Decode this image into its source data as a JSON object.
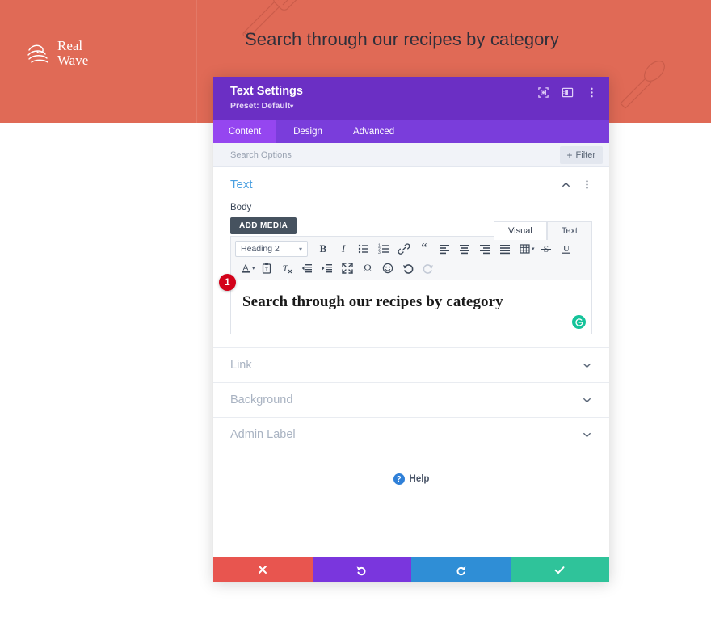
{
  "site": {
    "logo_line1": "Real",
    "logo_line2": "Wave",
    "logo_icon": "wave-lines-icon",
    "hero_heading": "Search through our recipes by category",
    "background_color": "#e06a56",
    "decorations": [
      "rolling-pin-icon",
      "spoon-icon"
    ]
  },
  "modal": {
    "title": "Text Settings",
    "preset_label": "Preset: Default",
    "preset_caret": "▾",
    "header_color": "#6b2fc4",
    "header_icons": [
      {
        "name": "focus-target-icon"
      },
      {
        "name": "panel-layout-icon"
      },
      {
        "name": "vertical-dots-icon"
      }
    ],
    "tabs": [
      {
        "label": "Content",
        "active": true
      },
      {
        "label": "Design",
        "active": false
      },
      {
        "label": "Advanced",
        "active": false
      }
    ],
    "search": {
      "placeholder": "Search Options",
      "filter_label": "Filter",
      "filter_plus": "+"
    },
    "section": {
      "title": "Text",
      "title_color": "#4a9fe0",
      "collapse_icon": "chevron-up-icon",
      "more_icon": "vertical-dots-icon",
      "field_label": "Body",
      "add_media_label": "ADD MEDIA",
      "editor_tabs": [
        {
          "label": "Visual",
          "active": true
        },
        {
          "label": "Text",
          "active": false
        }
      ],
      "format_select": "Heading 2",
      "select_caret": "▾",
      "toolbar_row1": [
        {
          "name": "bold-icon",
          "label": "B"
        },
        {
          "name": "italic-icon",
          "label": "I"
        },
        {
          "name": "bulleted-list-icon",
          "label": ""
        },
        {
          "name": "numbered-list-icon",
          "label": ""
        },
        {
          "name": "link-icon",
          "label": ""
        },
        {
          "name": "blockquote-icon",
          "label": "“"
        },
        {
          "name": "align-left-icon",
          "label": ""
        },
        {
          "name": "align-center-icon",
          "label": ""
        },
        {
          "name": "align-right-icon",
          "label": ""
        },
        {
          "name": "align-justify-icon",
          "label": ""
        },
        {
          "name": "table-icon",
          "label": ""
        },
        {
          "name": "strikethrough-icon",
          "label": "S"
        },
        {
          "name": "underline-icon",
          "label": "U"
        }
      ],
      "toolbar_row2": [
        {
          "name": "text-color-icon",
          "label": "A"
        },
        {
          "name": "paste-as-text-icon",
          "label": ""
        },
        {
          "name": "clear-formatting-icon",
          "label": ""
        },
        {
          "name": "outdent-icon",
          "label": ""
        },
        {
          "name": "indent-icon",
          "label": ""
        },
        {
          "name": "fullscreen-icon",
          "label": ""
        },
        {
          "name": "special-character-icon",
          "label": "Ω"
        },
        {
          "name": "emoji-icon",
          "label": ""
        },
        {
          "name": "undo-icon",
          "label": ""
        },
        {
          "name": "redo-icon",
          "label": ""
        }
      ],
      "editor_content": "Search through our recipes by category",
      "grammarly_icon": "grammarly-icon",
      "grammarly_color": "#15c39a",
      "step_badge": "1",
      "step_badge_color": "#d3021a"
    },
    "accordion": [
      {
        "label": "Link",
        "icon": "chevron-down-icon"
      },
      {
        "label": "Background",
        "icon": "chevron-down-icon"
      },
      {
        "label": "Admin Label",
        "icon": "chevron-down-icon"
      }
    ],
    "help": {
      "label": "Help",
      "icon": "question-mark-icon",
      "icon_color": "#2f80d8"
    },
    "footer": [
      {
        "name": "cancel-button",
        "icon": "close-x-icon",
        "color": "#e8554f"
      },
      {
        "name": "undo-button",
        "icon": "undo-arrow-icon",
        "color": "#7a36dd"
      },
      {
        "name": "redo-button",
        "icon": "redo-arrow-icon",
        "color": "#2f8ed6"
      },
      {
        "name": "save-button",
        "icon": "checkmark-icon",
        "color": "#2fc39a"
      }
    ]
  }
}
